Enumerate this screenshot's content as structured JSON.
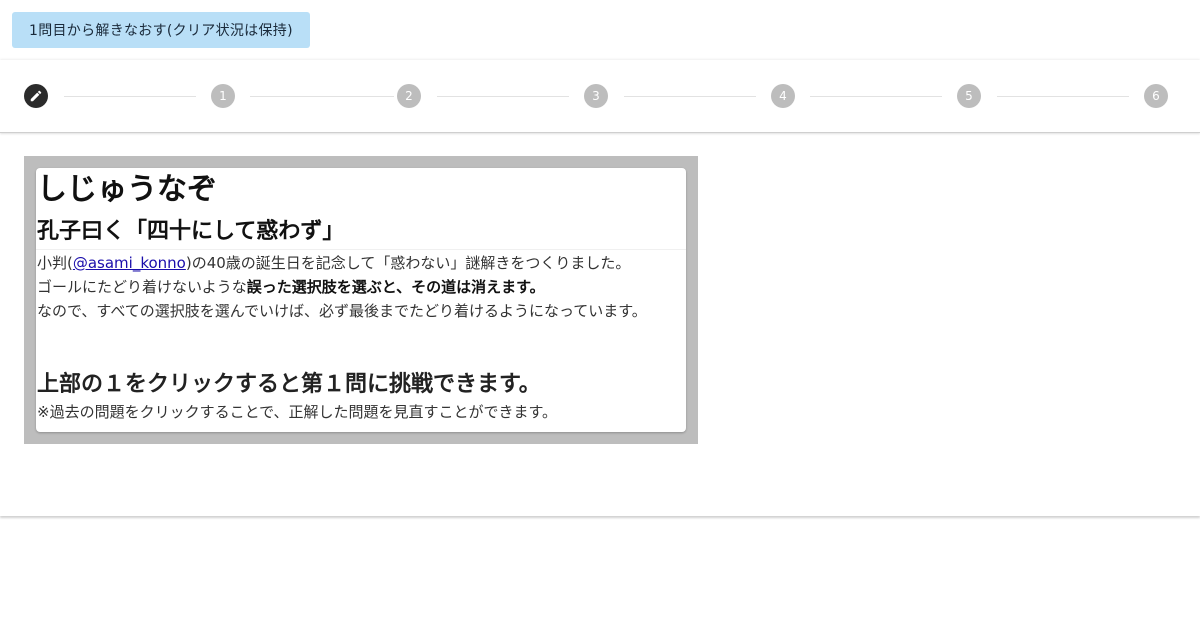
{
  "toolbar": {
    "restart_label": "1問目から解きなおす(クリア状況は保持)"
  },
  "stepper": {
    "steps": [
      {
        "icon": "pencil-icon",
        "label": ""
      },
      {
        "label": "1"
      },
      {
        "label": "2"
      },
      {
        "label": "3"
      },
      {
        "label": "4"
      },
      {
        "label": "5"
      },
      {
        "label": "6"
      }
    ]
  },
  "content": {
    "title": "しじゅうなぞ",
    "subtitle": "孔子曰く「四十にして惑わず」",
    "intro_line1_prefix": "小判(",
    "intro_line1_link": "@asami_konno",
    "intro_line1_suffix": ")の40歳の誕生日を記念して「惑わない」謎解きをつくりました。",
    "intro_line2_prefix": "ゴールにたどり着けないような",
    "intro_line2_bold": "誤った選択肢を選ぶと、その道は消えます。",
    "intro_line3": "なので、すべての選択肢を選んでいけば、必ず最後までたどり着けるようになっています。",
    "cta": "上部の１をクリックすると第１問に挑戦できます。",
    "note": "※過去の問題をクリックすることで、正解した問題を見直すことができます。"
  },
  "colors": {
    "restart_button_bg": "#b9dff7",
    "step_active": "#2b2b2b",
    "step_inactive": "#bdbdbd",
    "frame_gray": "#bdbdbd"
  }
}
